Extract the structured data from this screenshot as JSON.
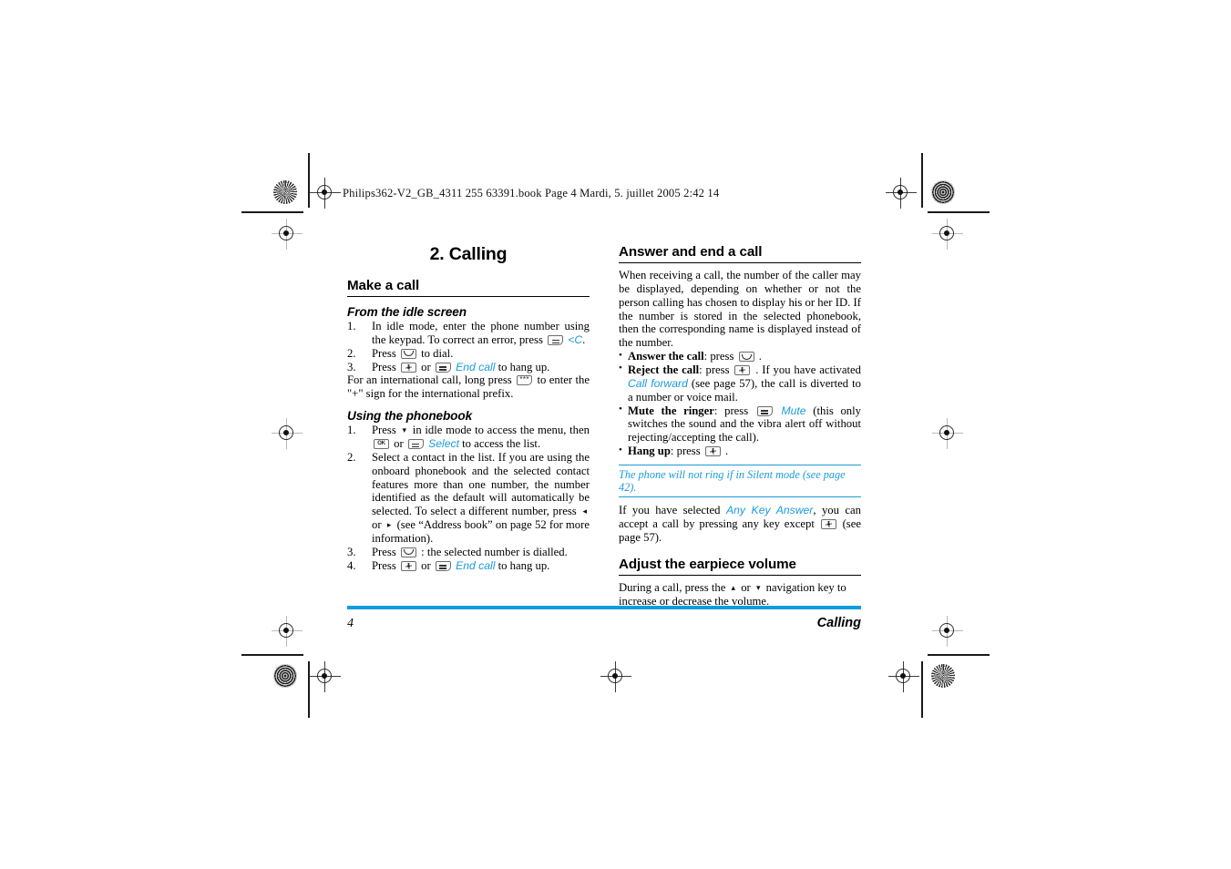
{
  "document": {
    "slug": "Philips362-V2_GB_4311 255 63391.book   Page 4   Mardi, 5. juillet 2005   2:42 14",
    "chapter_title": "2. Calling",
    "accent_color": "#1A9CDB",
    "footer_bar_color": "#0D9DDB"
  },
  "left_column": {
    "section_title": "Make a call",
    "sub1": {
      "heading": "From the idle screen",
      "steps": [
        {
          "num": "1.",
          "text_a": "In idle mode, enter the phone number using the keypad. To correct an error, press",
          "key": "softkey",
          "link": "<C",
          "text_b": "."
        },
        {
          "num": "2.",
          "text_a": "Press",
          "key": "pickup-key",
          "text_b": "to dial."
        },
        {
          "num": "3.",
          "text_a": "Press",
          "key1": "hangup-key",
          "mid": "or",
          "key2": "softkey",
          "link": "End call",
          "text_b": "to hang up."
        }
      ],
      "paragraph_a": "For an international call, long press",
      "paragraph_key": "star-key",
      "paragraph_b": "to enter the \"+\" sign for the international prefix."
    },
    "sub2": {
      "heading": "Using the phonebook",
      "steps": [
        {
          "num": "1.",
          "text_a": "Press",
          "nav": "▾",
          "text_b": "in idle mode to access the menu, then",
          "key1": "ok-key",
          "mid": "or",
          "key2": "softkey",
          "link": "Select",
          "text_c": "to access the list."
        },
        {
          "num": "2.",
          "text_a": "Select a contact in the list. If you are using the onboard phonebook and the selected contact features more than one number, the number identified as the default will automatically be selected. To select a different number, press",
          "nav1": "◂",
          "mid": "or",
          "nav2": "▸",
          "text_b": "(see “Address book” on page 52 for more information)."
        },
        {
          "num": "3.",
          "text_a": "Press",
          "key": "pickup-key",
          "text_b": ": the selected number is dialled."
        },
        {
          "num": "4.",
          "text_a": "Press",
          "key1": "hangup-key",
          "mid": "or",
          "key2": "softkey",
          "link": "End call",
          "text_b": "to hang up."
        }
      ]
    }
  },
  "right_column": {
    "section1_title": "Answer and end a call",
    "section1_intro": "When receiving a call, the number of the caller may be displayed, depending on whether or not the person calling has chosen to display his or her ID. If the number is stored in the selected phonebook, then the corresponding name is displayed instead of the number.",
    "bullets": [
      {
        "label": "Answer the call",
        "text_a": ": press",
        "key": "pickup-key",
        "text_b": "."
      },
      {
        "label": "Reject the call",
        "text_a": ": press",
        "key": "hangup-key",
        "text_b": ". If you have activated",
        "link": "Call forward",
        "text_c": "(see page 57), the call is diverted to a number or voice mail."
      },
      {
        "label": "Mute the ringer",
        "text_a": ": press",
        "key": "softkey",
        "link": "Mute",
        "text_b": "(this only switches the sound and the vibra alert off without rejecting/accepting the call)."
      },
      {
        "label": "Hang up",
        "text_a": ": press",
        "key": "hangup-key",
        "text_b": "."
      }
    ],
    "note": "The phone will not ring if in Silent mode (see page 42).",
    "after_note": {
      "text_a": "If you have selected",
      "link": "Any Key Answer",
      "text_b": ", you can accept a call by pressing any key except",
      "key": "hangup-key",
      "text_c": "(see page 57)."
    },
    "section2_title": "Adjust the earpiece volume",
    "section2_body": {
      "text_a": "During a call, press the",
      "nav1": "▴",
      "mid": "or",
      "nav2": "▾",
      "text_b": "navigation key to increase or decrease the volume."
    }
  },
  "footer": {
    "page_number": "4",
    "chapter_name": "Calling"
  }
}
